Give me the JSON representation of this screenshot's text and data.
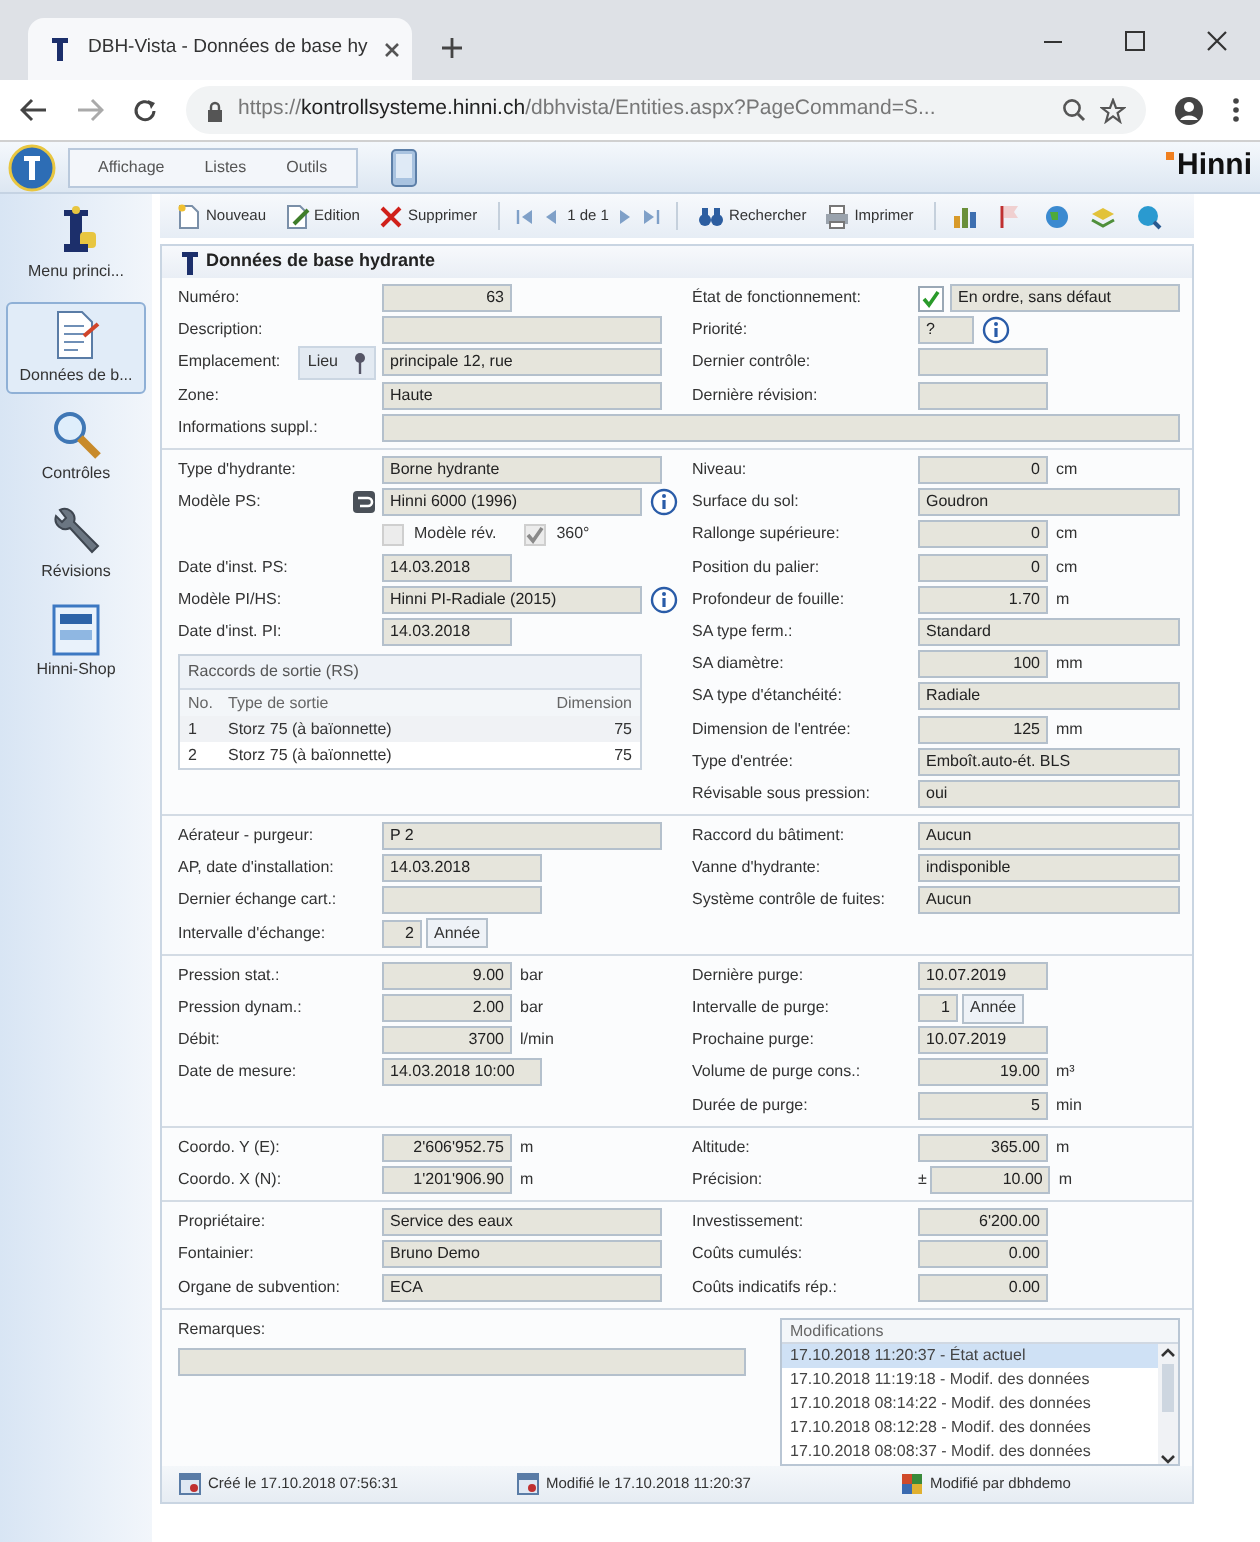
{
  "browser": {
    "tab_title": "DBH-Vista - Données de base hy",
    "url": "https://**kontrollsysteme.hinni.ch**/dbhvista/Entities.aspx?PageCommand=S..."
  },
  "app": {
    "menu": [
      "Affichage",
      "Listes",
      "Outils"
    ],
    "brand": "Hinni"
  },
  "toolbar": {
    "actions": [
      "Nouveau",
      "Edition",
      "Supprimer"
    ],
    "pager": "1 de 1",
    "tools": [
      "Rechercher",
      "Imprimer"
    ]
  },
  "sidebar": {
    "items": [
      {
        "label": "Menu princi...",
        "selected": false
      },
      {
        "label": "Données de b...",
        "selected": true
      },
      {
        "label": "Contrôles",
        "selected": false
      },
      {
        "label": "Révisions",
        "selected": false
      },
      {
        "label": "Hinni-Shop",
        "selected": false
      }
    ]
  },
  "form": {
    "title": "Données de base hydrante",
    "sections": [
      {
        "left": [
          {
            "label": "Numéro:",
            "value": "63",
            "kind": "num"
          },
          {
            "label": "Description:",
            "kind": "text"
          },
          {
            "label": "Emplacement:",
            "value": "principale 12, rue",
            "kind": "text",
            "button": "Lieu"
          },
          {
            "label": "Zone:",
            "value": "Haute",
            "kind": "text"
          }
        ],
        "right": [
          {
            "label": "État de fonctionnement:",
            "value": "En ordre, sans défaut",
            "kind": "wide",
            "checked": true
          },
          {
            "label": "Priorité:",
            "value": "?",
            "kind": "short",
            "info": true
          },
          {
            "label": "Dernier contrôle:",
            "kind": "date"
          },
          {
            "label": "Dernière révision:",
            "kind": "date"
          }
        ],
        "full": [
          {
            "label": "Informations suppl.:",
            "kind": "wide"
          }
        ]
      },
      {
        "left": [
          {
            "label": "Type d'hydrante:",
            "value": "Borne hydrante",
            "kind": "text"
          },
          {
            "label": "Modèle PS:",
            "value": "Hinni 6000 (1996)",
            "kind": "text",
            "picker": true,
            "info": true
          },
          {
            "kind": "checks",
            "items": [
              {
                "label": "Modèle rév.",
                "checked": false,
                "disabled": true
              },
              {
                "label": "360°",
                "checked": true,
                "disabled": true
              }
            ]
          },
          {
            "label": "Date d'inst. PS:",
            "value": "14.03.2018",
            "kind": "date"
          },
          {
            "label": "Modèle PI/HS:",
            "value": "Hinni PI-Radiale (2015)",
            "kind": "text",
            "info": true
          },
          {
            "label": "Date d'inst. PI:",
            "value": "14.03.2018",
            "kind": "date"
          },
          {
            "kind": "table",
            "title": "Raccords de sortie (RS)",
            "columns": [
              "No.",
              "Type de sortie",
              "Dimension"
            ],
            "rows": [
              [
                "1",
                "Storz 75 (à baïonnette)",
                "75"
              ],
              [
                "2",
                "Storz 75 (à baïonnette)",
                "75"
              ]
            ]
          }
        ],
        "right": [
          {
            "label": "Niveau:",
            "value": "0",
            "kind": "num",
            "unit": "cm"
          },
          {
            "label": "Surface du sol:",
            "value": "Goudron",
            "kind": "wide"
          },
          {
            "label": "Rallonge supérieure:",
            "value": "0",
            "kind": "num",
            "unit": "cm"
          },
          {
            "label": "Position du palier:",
            "value": "0",
            "kind": "num",
            "unit": "cm"
          },
          {
            "label": "Profondeur de fouille:",
            "value": "1.70",
            "kind": "num",
            "unit": "m"
          },
          {
            "label": "SA type ferm.:",
            "value": "Standard",
            "kind": "wide"
          },
          {
            "label": "SA diamètre:",
            "value": "100",
            "kind": "num",
            "unit": "mm"
          },
          {
            "label": "SA type d'étanchéité:",
            "value": "Radiale",
            "kind": "wide"
          },
          {
            "label": "Dimension de l'entrée:",
            "value": "125",
            "kind": "num",
            "unit": "mm"
          },
          {
            "label": "Type d'entrée:",
            "value": "Emboît.auto-ét. BLS",
            "kind": "wide"
          },
          {
            "label": "Révisable sous pression:",
            "value": "oui",
            "kind": "wide"
          }
        ]
      },
      {
        "left": [
          {
            "label": "Aérateur - purgeur:",
            "value": "P 2",
            "kind": "text"
          },
          {
            "label": "AP, date d'installation:",
            "value": "14.03.2018",
            "kind": "datetime"
          },
          {
            "label": "Dernier échange cart.:",
            "kind": "datetime"
          },
          {
            "label": "Intervalle d'échange:",
            "value": "2",
            "kind": "tiny",
            "unit_button": "Année"
          }
        ],
        "right": [
          {
            "label": "Raccord du bâtiment:",
            "value": "Aucun",
            "kind": "wide"
          },
          {
            "label": "Vanne d'hydrante:",
            "value": "indisponible",
            "kind": "wide"
          },
          {
            "label": "Système contrôle de fuites:",
            "value": "Aucun",
            "kind": "wide"
          }
        ]
      },
      {
        "left": [
          {
            "label": "Pression stat.:",
            "value": "9.00",
            "kind": "num",
            "unit": "bar"
          },
          {
            "label": "Pression dynam.:",
            "value": "2.00",
            "kind": "num",
            "unit": "bar"
          },
          {
            "label": "Débit:",
            "value": "3700",
            "kind": "num",
            "unit": "l/min"
          },
          {
            "label": "Date de mesure:",
            "value": "14.03.2018 10:00",
            "kind": "datetime"
          }
        ],
        "right": [
          {
            "label": "Dernière purge:",
            "value": "10.07.2019",
            "kind": "date"
          },
          {
            "label": "Intervalle de purge:",
            "value": "1",
            "kind": "tiny",
            "unit_button": "Année"
          },
          {
            "label": "Prochaine purge:",
            "value": "10.07.2019",
            "kind": "date"
          },
          {
            "label": "Volume de purge cons.:",
            "value": "19.00",
            "kind": "num",
            "unit": "m³"
          },
          {
            "label": "Durée de purge:",
            "value": "5",
            "kind": "num",
            "unit": "min"
          }
        ]
      },
      {
        "left": [
          {
            "label": "Coordo. Y (E):",
            "value": "2'606'952.75",
            "kind": "num",
            "unit": "m"
          },
          {
            "label": "Coordo. X (N):",
            "value": "1'201'906.90",
            "kind": "num",
            "unit": "m"
          }
        ],
        "right": [
          {
            "label": "Altitude:",
            "value": "365.00",
            "kind": "num",
            "unit": "m"
          },
          {
            "label": "Précision:",
            "value": "10.00",
            "kind": "num",
            "unit": "m",
            "prefix": "±"
          }
        ]
      },
      {
        "left": [
          {
            "label": "Propriétaire:",
            "value": "Service des eaux",
            "kind": "text"
          },
          {
            "label": "Fontainier:",
            "value": "Bruno Demo",
            "kind": "text"
          },
          {
            "label": "Organe de subvention:",
            "value": "ECA",
            "kind": "text"
          }
        ],
        "right": [
          {
            "label": "Investissement:",
            "value": "6'200.00",
            "kind": "num"
          },
          {
            "label": "Coûts cumulés:",
            "value": "0.00",
            "kind": "num"
          },
          {
            "label": "Coûts indicatifs rép.:",
            "value": "0.00",
            "kind": "num"
          }
        ]
      }
    ],
    "remarks": {
      "label": "Remarques:"
    },
    "modifications": {
      "title": "Modifications",
      "items": [
        {
          "text": "17.10.2018 11:20:37 - État actuel",
          "selected": true
        },
        {
          "text": "17.10.2018 11:19:18 - Modif. des données",
          "selected": false
        },
        {
          "text": "17.10.2018 08:14:22 - Modif. des données",
          "selected": false
        },
        {
          "text": "17.10.2018 08:12:28 - Modif. des données",
          "selected": false
        },
        {
          "text": "17.10.2018 08:08:37 - Modif. des données",
          "selected": false
        }
      ]
    }
  },
  "status_bar": [
    "Créé le 17.10.2018 07:56:31",
    "Modifié le 17.10.2018 11:20:37",
    "Modifié par dbhdemo"
  ]
}
